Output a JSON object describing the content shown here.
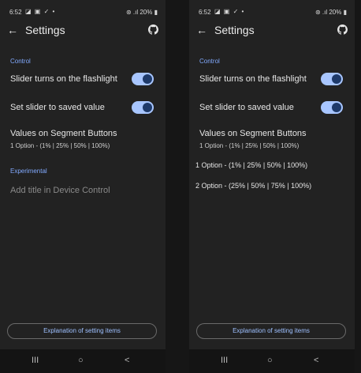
{
  "screens": [
    {
      "status": {
        "time": "6:52",
        "icons": "◪ ▣ ✓ •",
        "right": "⊛ .ıl 20% ▮"
      },
      "title": "Settings",
      "control_header": "Control",
      "toggles": [
        {
          "label": "Slider turns on the flashlight",
          "on": true
        },
        {
          "label": "Set slider to saved value",
          "on": true
        }
      ],
      "segment": {
        "title": "Values on Segment Buttons",
        "value": "1 Option - (1% | 25% | 50% | 100%)"
      },
      "experimental_header": "Experimental",
      "device_control": "Add title in Device Control",
      "explain_button": "Explanation of setting items",
      "nav": {
        "recents": "III",
        "home": "○",
        "back": "<"
      }
    },
    {
      "status": {
        "time": "6:52",
        "icons": "◪ ▣ ✓ •",
        "right": "⊛ .ıl 20% ▮"
      },
      "title": "Settings",
      "control_header": "Control",
      "toggles": [
        {
          "label": "Slider turns on the flashlight",
          "on": true
        },
        {
          "label": "Set slider to saved value",
          "on": true
        }
      ],
      "segment": {
        "title": "Values on Segment Buttons",
        "value": "1 Option - (1% | 25% | 50% | 100%)"
      },
      "dropdown_options": [
        "1 Option - (1% | 25% | 50% | 100%)",
        "2 Option - (25% | 50% | 75% | 100%)"
      ],
      "explain_button": "Explanation of setting items",
      "nav": {
        "recents": "III",
        "home": "○",
        "back": "<"
      }
    }
  ],
  "colors": {
    "accent": "#82aaff",
    "toggle_track": "#a8c6ff",
    "toggle_knob": "#1e3a6a",
    "background": "#222222"
  }
}
